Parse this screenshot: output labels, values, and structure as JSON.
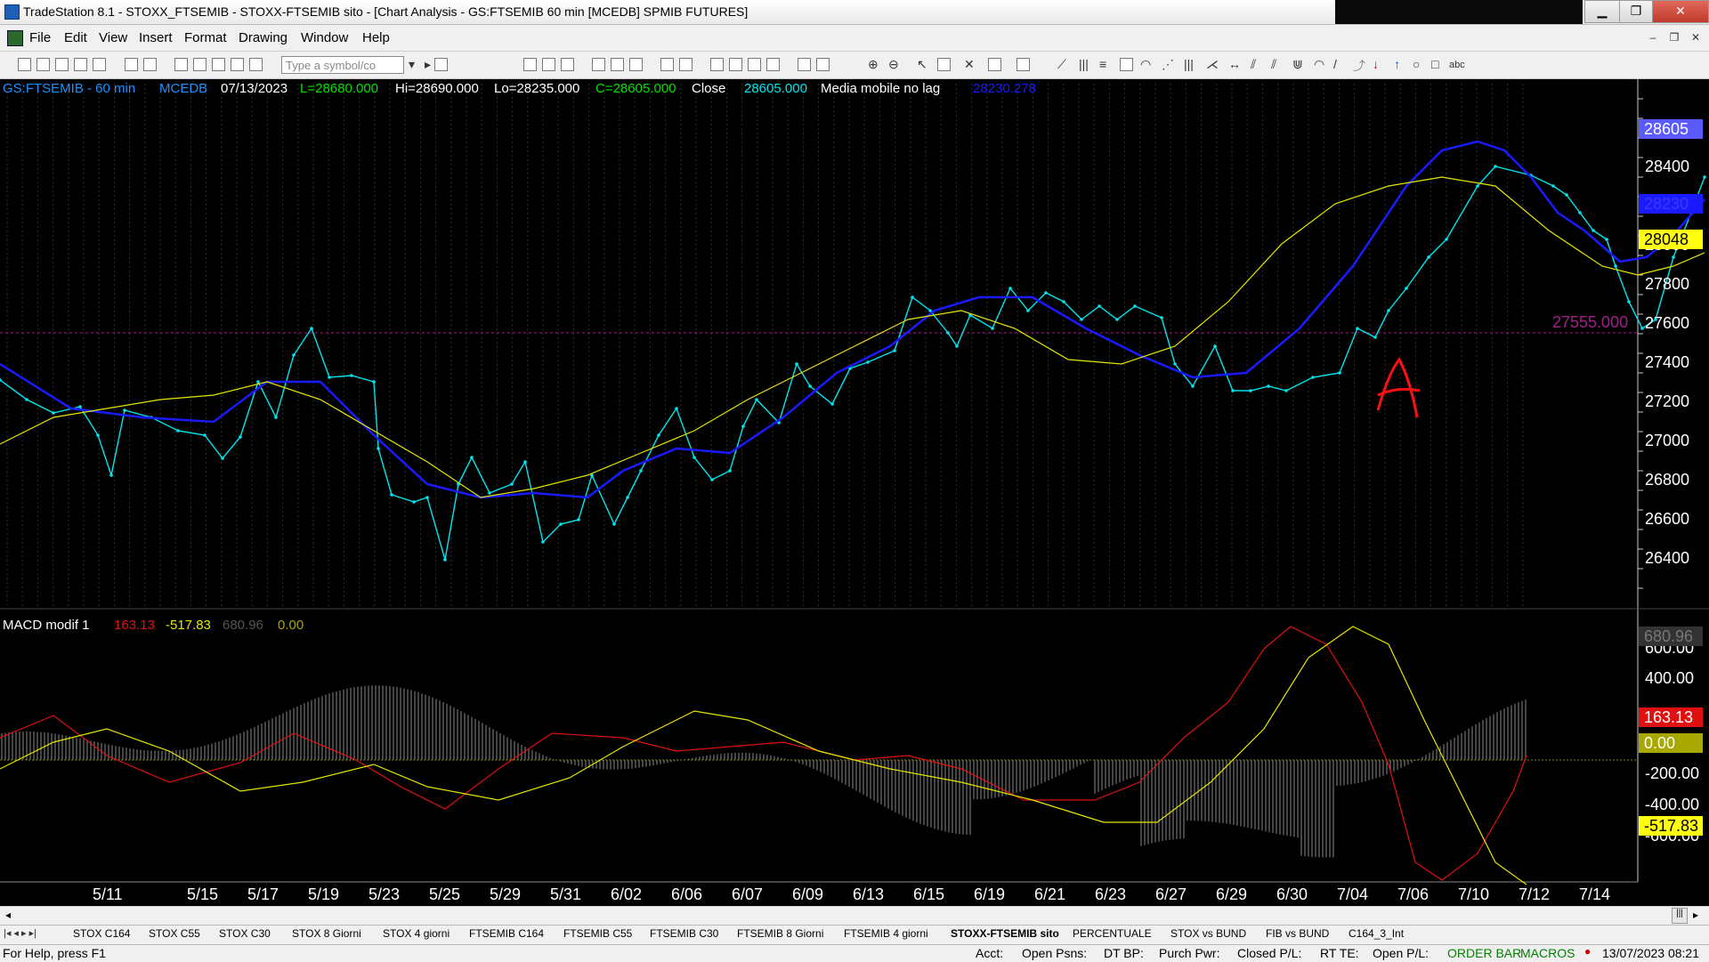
{
  "window": {
    "title": "TradeStation 8.1 - STOXX_FTSEMIB - STOXX-FTSEMIB sito - [Chart Analysis - GS:FTSEMIB  60 min  [MCEDB] SPMIB FUTURES]",
    "minimize": "▁",
    "restore": "❐",
    "close": "✕"
  },
  "menu": {
    "items": [
      "File",
      "Edit",
      "View",
      "Insert",
      "Format",
      "Drawing",
      "Window",
      "Help"
    ],
    "doc_minimize": "–",
    "doc_restore": "❐",
    "doc_close": "✕"
  },
  "toolbar": {
    "symbol_placeholder": "Type a symbol/co"
  },
  "chart": {
    "header": {
      "symbol": "GS:FTSEMIB - 60 min",
      "exchange": "MCEDB",
      "date": "07/13/2023",
      "low_field": "L=28680.000",
      "hi_field": "Hi=28690.000",
      "lo_field": "Lo=28235.000",
      "close_field": "C=28605.000",
      "close_label": "Close",
      "close_value": "28605.000",
      "ma_label": "Media mobile no lag",
      "ma_value": "28230.278"
    },
    "colors": {
      "price": "#00e5ee",
      "ma_blue": "#1a1aff",
      "ma_yellow": "#e6e600",
      "macd_red": "#e01010",
      "hist": "#8a8a8a",
      "annotation": "#ff1010",
      "level_line": "#a0208a"
    },
    "y_ticks": [
      "28400",
      "28000",
      "27800",
      "27600",
      "27400",
      "27200",
      "27000",
      "26800",
      "26600",
      "26400"
    ],
    "price_boxes": {
      "last": "28605",
      "ma_blue": "28230",
      "ma_yellow": "28048"
    },
    "level_line_label": "27555.000",
    "annotation": "A",
    "x_labels": [
      "5/11",
      "5/15",
      "5/17",
      "5/19",
      "5/23",
      "5/25",
      "5/29",
      "5/31",
      "6/02",
      "6/06",
      "6/07",
      "6/09",
      "6/13",
      "6/15",
      "6/19",
      "6/21",
      "6/23",
      "6/27",
      "6/29",
      "6/30",
      "7/04",
      "7/06",
      "7/10",
      "7/12",
      "7/14"
    ]
  },
  "macd": {
    "title": "MACD modif 1",
    "v1": "163.13",
    "v2": "-517.83",
    "v3": "680.96",
    "v4": "0.00",
    "y_ticks": [
      "600.00",
      "400.00",
      "200.00",
      "-200.00",
      "-400.00",
      "-600.00"
    ],
    "boxes": {
      "hist": "680.96",
      "macd": "163.13",
      "zero": "0.00",
      "signal": "-517.83"
    }
  },
  "tabs": [
    "STOX C164",
    "STOX C55",
    "STOX  C30",
    "STOX  8 Giorni",
    "STOX 4 giorni",
    "FTSEMIB C164",
    "FTSEMIB C55",
    "FTSEMIB C30",
    "FTSEMIB  8 Giorni",
    "FTSEMIB  4 giorni",
    "STOXX-FTSEMIB sito",
    "PERCENTUALE",
    "STOX vs BUND",
    "FIB vs BUND",
    "C164_3_Int"
  ],
  "status": {
    "help": "For Help, press F1",
    "acct": "Acct:",
    "open_psns": "Open Psns:",
    "dt_bp": "DT BP:",
    "purch_pwr": "Purch Pwr:",
    "closed_pl": "Closed P/L:",
    "rt_te": "RT TE:",
    "open_pl": "Open P/L:",
    "order_bar": "ORDER BAR",
    "macros": "MACROS",
    "datetime": "13/07/2023 08:21"
  }
}
